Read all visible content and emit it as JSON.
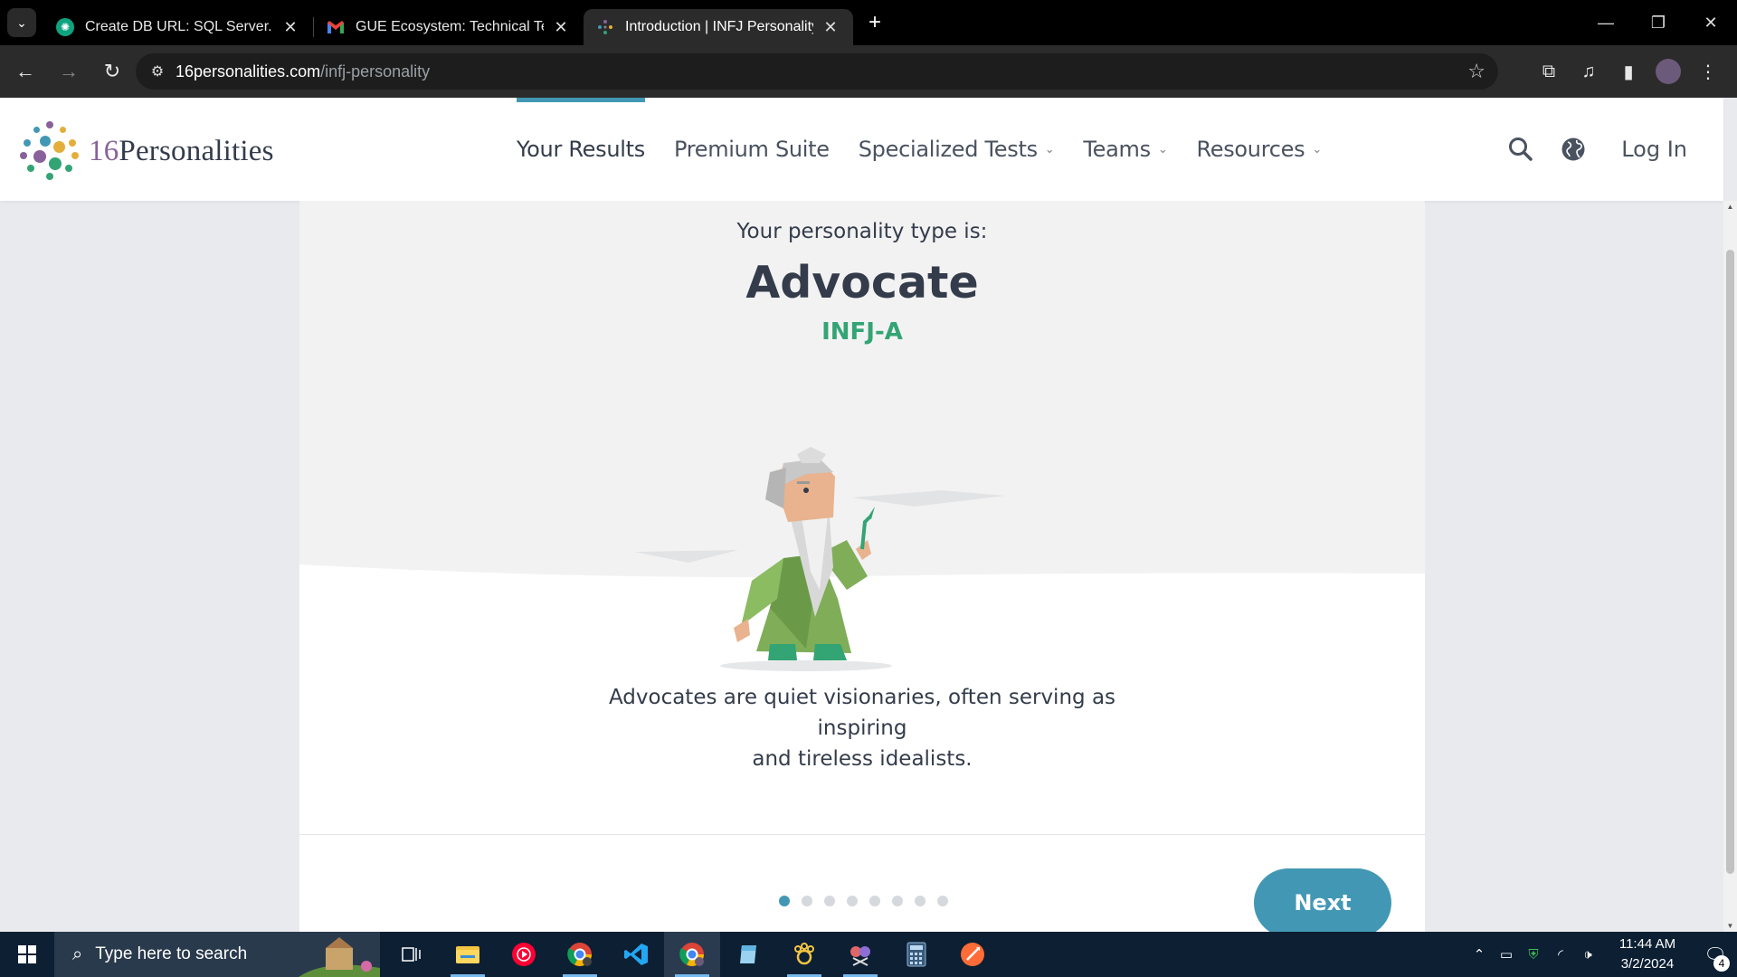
{
  "browser": {
    "tabs": [
      {
        "title": "Create DB URL: SQL Server.",
        "icon": "chatgpt-icon",
        "active": false
      },
      {
        "title": "GUE Ecosystem: Technical Test I",
        "icon": "gmail-icon",
        "active": false
      },
      {
        "title": "Introduction | INFJ Personality (",
        "icon": "16personalities-icon",
        "active": true
      }
    ],
    "url_host": "16personalities.com",
    "url_path": "/infj-personality"
  },
  "site": {
    "logo": {
      "num": "16",
      "text": "Personalities"
    },
    "nav": [
      {
        "label": "Your Results",
        "active": true,
        "dropdown": false
      },
      {
        "label": "Premium Suite",
        "active": false,
        "dropdown": false
      },
      {
        "label": "Specialized Tests",
        "active": false,
        "dropdown": true
      },
      {
        "label": "Teams",
        "active": false,
        "dropdown": true
      },
      {
        "label": "Resources",
        "active": false,
        "dropdown": true
      }
    ],
    "login_label": "Log In",
    "accent": "#4298b4"
  },
  "result": {
    "kicker": "Your personality type is:",
    "type_name": "Advocate",
    "type_code": "INFJ-A",
    "code_color": "#33a474",
    "description_line1": "Advocates are quiet visionaries, often serving as inspiring",
    "description_line2": "and tireless idealists.",
    "pager": {
      "total": 8,
      "current": 1
    },
    "next_label": "Next"
  },
  "taskbar": {
    "search_placeholder": "Type here to search",
    "time": "11:44 AM",
    "date": "3/2/2024",
    "notifications": "4"
  }
}
